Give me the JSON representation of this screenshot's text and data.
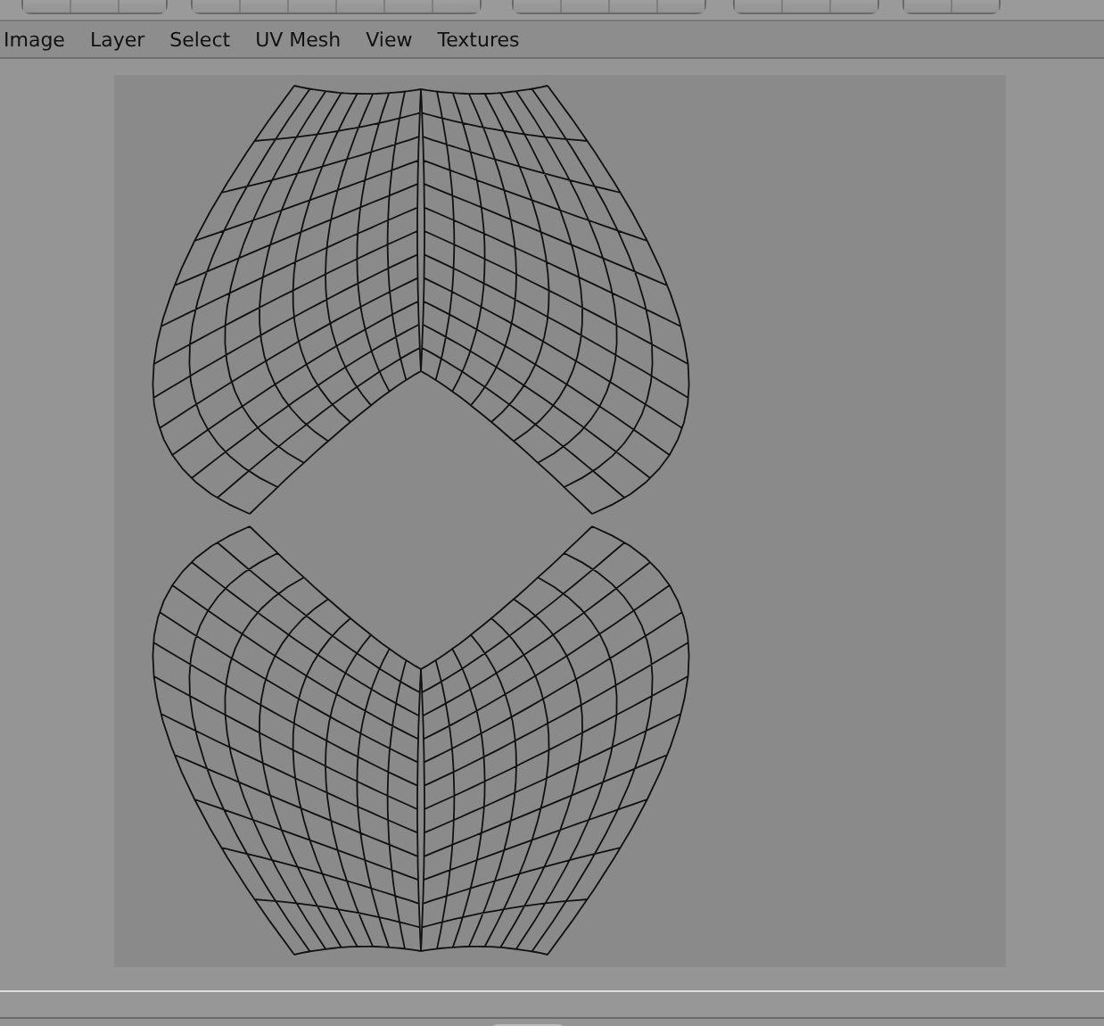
{
  "menu_bar": {
    "items": [
      {
        "label": "Image"
      },
      {
        "label": "Layer"
      },
      {
        "label": "Select"
      },
      {
        "label": "UV Mesh"
      },
      {
        "label": "View"
      },
      {
        "label": "Textures"
      }
    ]
  }
}
